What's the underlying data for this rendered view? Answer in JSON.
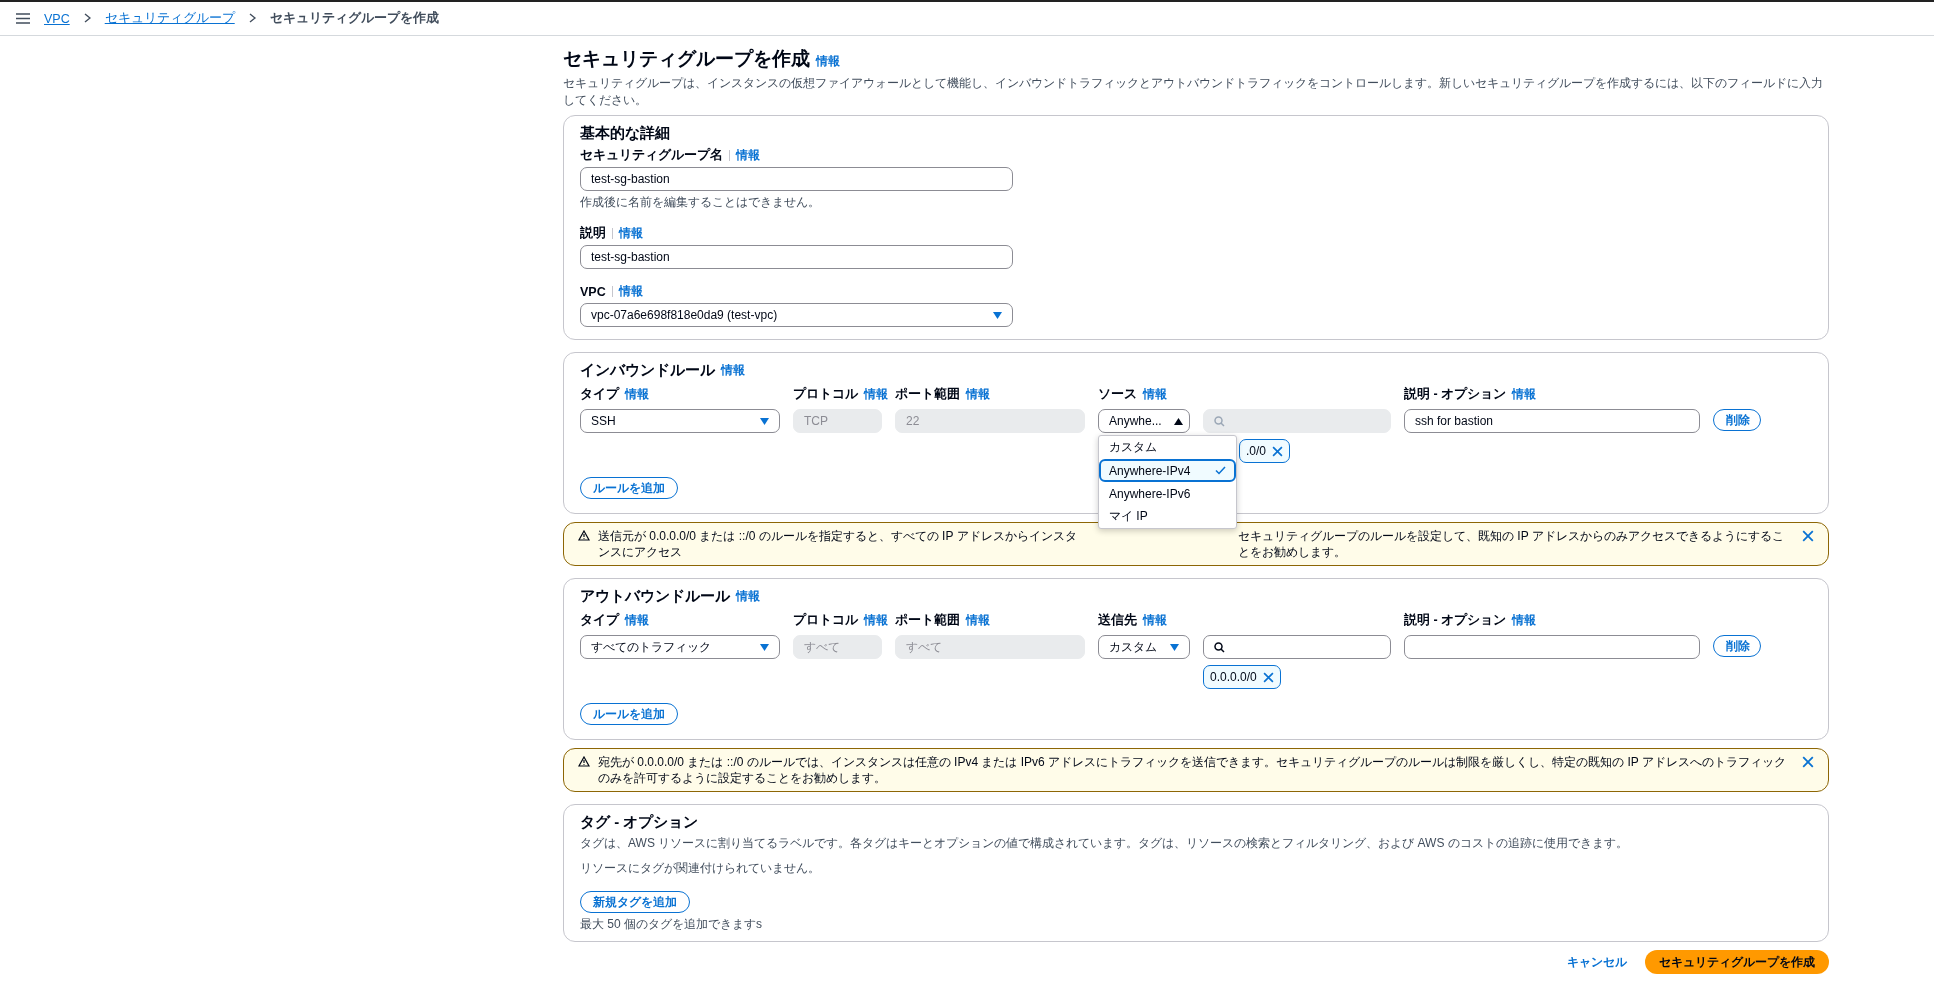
{
  "breadcrumb": [
    {
      "label": "VPC",
      "link": true
    },
    {
      "label": "セキュリティグループ",
      "link": true
    },
    {
      "label": "セキュリティグループを作成",
      "link": false
    }
  ],
  "page": {
    "title": "セキュリティグループを作成",
    "info": "情報",
    "description": "セキュリティグループは、インスタンスの仮想ファイアウォールとして機能し、インバウンドトラフィックとアウトバウンドトラフィックをコントロールします。新しいセキュリティグループを作成するには、以下のフィールドに入力してください。"
  },
  "basic": {
    "heading": "基本的な詳細",
    "fields": [
      {
        "kind": "text",
        "label": "セキュリティグループ名",
        "info": "情報",
        "value": "test-sg-bastion",
        "hint": "作成後に名前を編集することはできません。"
      },
      {
        "kind": "text",
        "label": "説明",
        "info": "情報",
        "value": "test-sg-bastion"
      },
      {
        "kind": "select",
        "label": "VPC",
        "info": "情報",
        "value": "vpc-07a6e698f818e0da9 (test-vpc)"
      }
    ]
  },
  "inbound": {
    "heading": "インバウンドルール",
    "info": "情報",
    "columns": [
      {
        "label": "タイプ",
        "info": "情報"
      },
      {
        "label": "プロトコル",
        "info": "情報"
      },
      {
        "label": "ポート範囲",
        "info": "情報"
      },
      {
        "label": "ソース",
        "info": "情報"
      },
      {
        "label": "説明 - オプション",
        "info": "情報"
      }
    ],
    "rules": [
      {
        "type": "SSH",
        "protocol": "TCP",
        "protocol_disabled": true,
        "port": "22",
        "port_disabled": true,
        "source": "Anywhe...",
        "source_expanded": true,
        "search_disabled": true,
        "description": "ssh for bastion",
        "delete": "削除",
        "chips": [
          ".0/0"
        ],
        "source_options": [
          {
            "label": "カスタム",
            "selected": false
          },
          {
            "label": "Anywhere-IPv4",
            "selected": true
          },
          {
            "label": "Anywhere-IPv6",
            "selected": false
          },
          {
            "label": "マイ IP",
            "selected": false
          }
        ]
      }
    ],
    "add": "ルールを追加",
    "warning": {
      "texts": [
        "送信元が 0.0.0.0/0 または ::/0 のルールを指定すると、すべての IP アドレスからインスタンスにアクセス",
        "セキュリティグループのルールを設定して、既知の IP アドレスからのみアクセスできるようにすることをお勧めします。"
      ]
    }
  },
  "outbound": {
    "heading": "アウトバウンドルール",
    "info": "情報",
    "columns": [
      {
        "label": "タイプ",
        "info": "情報"
      },
      {
        "label": "プロトコル",
        "info": "情報"
      },
      {
        "label": "ポート範囲",
        "info": "情報"
      },
      {
        "label": "送信先",
        "info": "情報"
      },
      {
        "label": "説明 - オプション",
        "info": "情報"
      }
    ],
    "rules": [
      {
        "type": "すべてのトラフィック",
        "protocol": "すべて",
        "protocol_disabled": true,
        "port": "すべて",
        "port_disabled": true,
        "source": "カスタム",
        "source_expanded": false,
        "search_disabled": false,
        "delete": "削除",
        "chips": [
          "0.0.0.0/0"
        ]
      }
    ],
    "add": "ルールを追加",
    "warning": {
      "texts": [
        "宛先が 0.0.0.0/0 または ::/0 のルールでは、インスタンスは任意の IPv4 または IPv6 アドレスにトラフィックを送信できます。セキュリティグループのルールは制限を厳しくし、特定の既知の IP アドレスへのトラフィックのみを許可するように設定することをお勧めします。"
      ]
    }
  },
  "tags": {
    "heading": "タグ - オプション",
    "description": "タグは、AWS リソースに割り当てるラベルです。各タグはキーとオプションの値で構成されています。タグは、リソースの検索とフィルタリング、および AWS のコストの追跡に使用できます。",
    "empty": "リソースにタグが関連付けられていません。",
    "add": "新規タグを追加",
    "limit": "最大 50 個のタグを追加できますs"
  },
  "footer": {
    "cancel": "キャンセル",
    "create": "セキュリティグループを作成"
  }
}
